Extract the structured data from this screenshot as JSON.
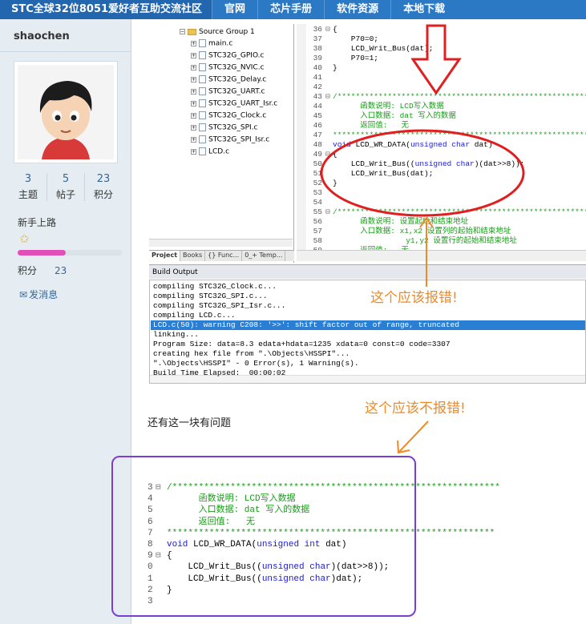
{
  "topnav": {
    "site_title": "STC全球32位8051爱好者互助交流社区",
    "items": [
      "官网",
      "芯片手册",
      "软件资源",
      "本地下载"
    ]
  },
  "sidebar": {
    "username": "shaochen",
    "stats": [
      {
        "num": "3",
        "label": "主题"
      },
      {
        "num": "5",
        "label": "帖子"
      },
      {
        "num": "23",
        "label": "积分"
      }
    ],
    "rank": "新手上路",
    "progress_fraction": 0.46,
    "points_label": "积分",
    "points_value": "23",
    "message_label": "发消息"
  },
  "ide": {
    "project_tree": {
      "group": "Source Group 1",
      "files": [
        "main.c",
        "STC32G_GPIO.c",
        "STC32G_NVIC.c",
        "STC32G_Delay.c",
        "STC32G_UART.c",
        "STC32G_UART_Isr.c",
        "STC32G_Clock.c",
        "STC32G_SPI.c",
        "STC32G_SPI_Isr.c",
        "LCD.c"
      ]
    },
    "project_tabs": [
      "Project",
      "Books",
      "{} Func...",
      "0_+ Temp..."
    ],
    "code_lines": [
      {
        "n": "36",
        "fold": "⊟",
        "text": "{"
      },
      {
        "n": "37",
        "fold": "",
        "text": "    P70=0;"
      },
      {
        "n": "38",
        "fold": "",
        "text": "    LCD_Writ_Bus(dat);"
      },
      {
        "n": "39",
        "fold": "",
        "text": "    P70=1;"
      },
      {
        "n": "40",
        "fold": "",
        "text": "}"
      },
      {
        "n": "41",
        "fold": "",
        "text": ""
      },
      {
        "n": "42",
        "fold": "",
        "text": ""
      },
      {
        "n": "43",
        "fold": "⊟",
        "text": "/**********************************************************"
      },
      {
        "n": "44",
        "fold": "",
        "text": "      函数说明: LCD写入数据"
      },
      {
        "n": "45",
        "fold": "",
        "text": "      入口数据: dat 写入的数据"
      },
      {
        "n": "46",
        "fold": "",
        "text": "      返回值:   无"
      },
      {
        "n": "47",
        "fold": "",
        "text": "**********************************************************"
      },
      {
        "n": "48",
        "fold": "",
        "text": "void LCD_WR_DATA(unsigned char dat)"
      },
      {
        "n": "49",
        "fold": "⊟",
        "text": "{"
      },
      {
        "n": "50",
        "fold": "",
        "text": "    LCD_Writ_Bus((unsigned char)(dat>>8));"
      },
      {
        "n": "51",
        "fold": "",
        "text": "    LCD_Writ_Bus(dat);"
      },
      {
        "n": "52",
        "fold": "",
        "text": "}"
      },
      {
        "n": "53",
        "fold": "",
        "text": ""
      },
      {
        "n": "54",
        "fold": "",
        "text": ""
      },
      {
        "n": "55",
        "fold": "⊟",
        "text": "/**********************************************************"
      },
      {
        "n": "56",
        "fold": "",
        "text": "      函数说明: 设置起始和结束地址"
      },
      {
        "n": "57",
        "fold": "",
        "text": "      入口数据: x1,x2 设置列的起始和结束地址"
      },
      {
        "n": "58",
        "fold": "",
        "text": "                y1,y2 设置行的起始和结束地址"
      },
      {
        "n": "59",
        "fold": "",
        "text": "      返回值:   无"
      }
    ],
    "build_title": "Build Output",
    "build_lines": [
      "compiling STC32G_Clock.c...",
      "compiling STC32G_SPI.c...",
      "compiling STC32G_SPI_Isr.c...",
      "compiling LCD.c...",
      "LCD.c(50): warning C208: '>>': shift factor out of range, truncated",
      "linking...",
      "Program Size: data=8.3 edata+hdata=1235 xdata=0 const=0 code=3307",
      "creating hex file from \".\\Objects\\HSSPI\"...",
      "\".\\Objects\\HSSPI\" - 0 Error(s), 1 Warning(s).",
      "Build Time Elapsed:  00:00:02"
    ]
  },
  "annotations": {
    "should_error": "这个应该报错!",
    "should_not_error": "这个应该不报错!"
  },
  "body_text": "还有这一块有问题",
  "code2_lines": [
    {
      "n": "3",
      "fold": "⊟",
      "text": "/**************************************************************"
    },
    {
      "n": "4",
      "fold": "",
      "text": "      函数说明: LCD写入数据"
    },
    {
      "n": "5",
      "fold": "",
      "text": "      入口数据: dat 写入的数据"
    },
    {
      "n": "6",
      "fold": "",
      "text": "      返回值:   无"
    },
    {
      "n": "7",
      "fold": "",
      "text": "**************************************************************"
    },
    {
      "n": "8",
      "fold": "",
      "text": "void LCD_WR_DATA(unsigned int dat)"
    },
    {
      "n": "9",
      "fold": "⊟",
      "text": "{"
    },
    {
      "n": "0",
      "fold": "",
      "text": "    LCD_Writ_Bus((unsigned char)(dat>>8));"
    },
    {
      "n": "1",
      "fold": "",
      "text": "    LCD_Writ_Bus((unsigned char)dat);"
    },
    {
      "n": "2",
      "fold": "",
      "text": "}"
    },
    {
      "n": "3",
      "fold": "",
      "text": ""
    }
  ],
  "colors": {
    "nav_bg": "#2b78c5",
    "sidebar_bg": "#e5edf2",
    "annotation": "#f08a24",
    "ellipse": "#e02020",
    "purple_box": "#7a3fd0",
    "comment": "#1a9c1a",
    "keyword": "#1a1ad6",
    "selected_line": "#2a7fd4"
  }
}
